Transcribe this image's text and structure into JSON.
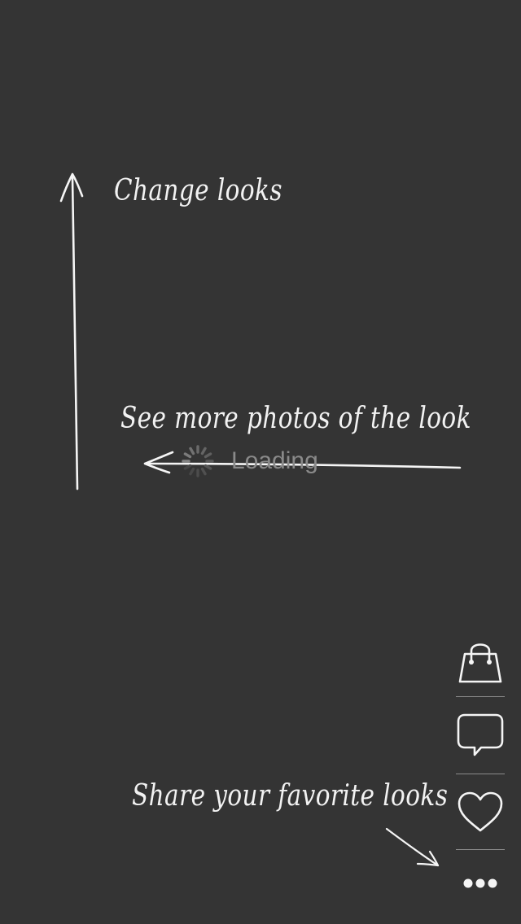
{
  "screen": {
    "background_color": "#343434",
    "text_color": "#f2f2f2"
  },
  "hints": {
    "change_looks": "Change looks",
    "more_photos": "See more photos of the look",
    "share": "Share your favorite looks"
  },
  "loading": {
    "label": "Loading",
    "icon": "spinner-icon"
  },
  "actions": [
    {
      "name": "shopping-bag",
      "icon": "shopping-bag-icon"
    },
    {
      "name": "comment",
      "icon": "speech-bubble-icon"
    },
    {
      "name": "favorite",
      "icon": "heart-icon"
    },
    {
      "name": "more",
      "icon": "ellipsis-icon"
    }
  ]
}
